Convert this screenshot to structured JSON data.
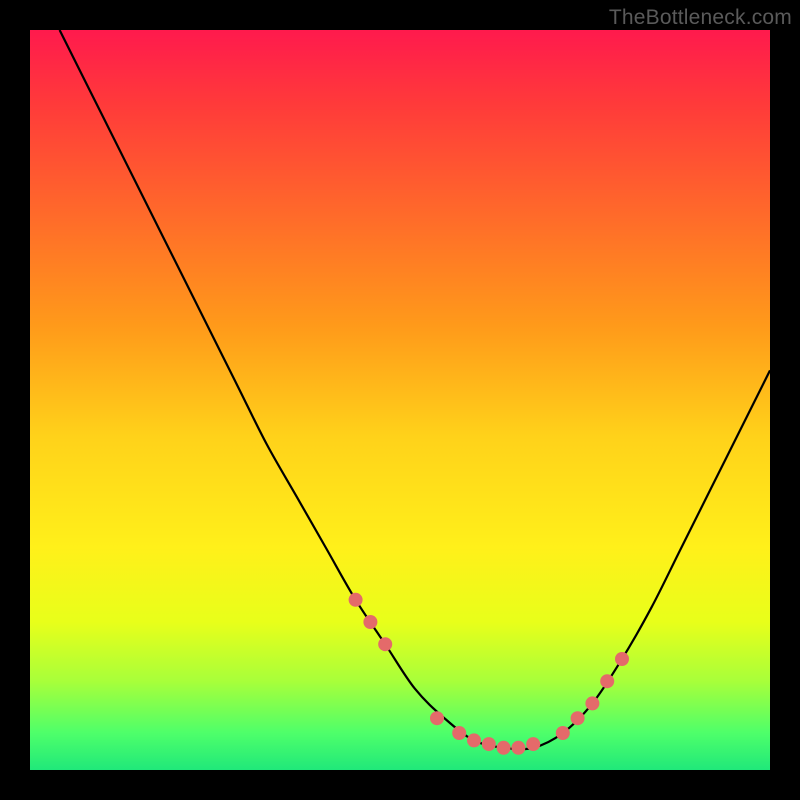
{
  "watermark": "TheBottleneck.com",
  "colors": {
    "page_bg": "#000000",
    "gradient_top": "#ff1a4d",
    "gradient_mid": "#fff01a",
    "gradient_bottom": "#20e87a",
    "curve_stroke": "#000000",
    "marker_fill": "#e46a6a",
    "marker_stroke": "#c84f4f"
  },
  "chart_data": {
    "type": "line",
    "title": "",
    "xlabel": "",
    "ylabel": "",
    "xlim": [
      0,
      100
    ],
    "ylim": [
      0,
      100
    ],
    "grid": false,
    "legend": false,
    "series": [
      {
        "name": "bottleneck-curve",
        "x": [
          4,
          8,
          12,
          16,
          20,
          24,
          28,
          32,
          36,
          40,
          44,
          48,
          52,
          56,
          60,
          64,
          68,
          72,
          76,
          80,
          84,
          88,
          92,
          96,
          100
        ],
        "y": [
          100,
          92,
          84,
          76,
          68,
          60,
          52,
          44,
          37,
          30,
          23,
          17,
          11,
          7,
          4,
          3,
          3,
          5,
          9,
          15,
          22,
          30,
          38,
          46,
          54
        ]
      }
    ],
    "markers": {
      "name": "highlighted-points",
      "x": [
        44,
        46,
        48,
        55,
        58,
        60,
        62,
        64,
        66,
        68,
        72,
        74,
        76,
        78,
        80
      ],
      "y": [
        23,
        20,
        17,
        7,
        5,
        4,
        3.5,
        3,
        3,
        3.5,
        5,
        7,
        9,
        12,
        15
      ]
    }
  }
}
